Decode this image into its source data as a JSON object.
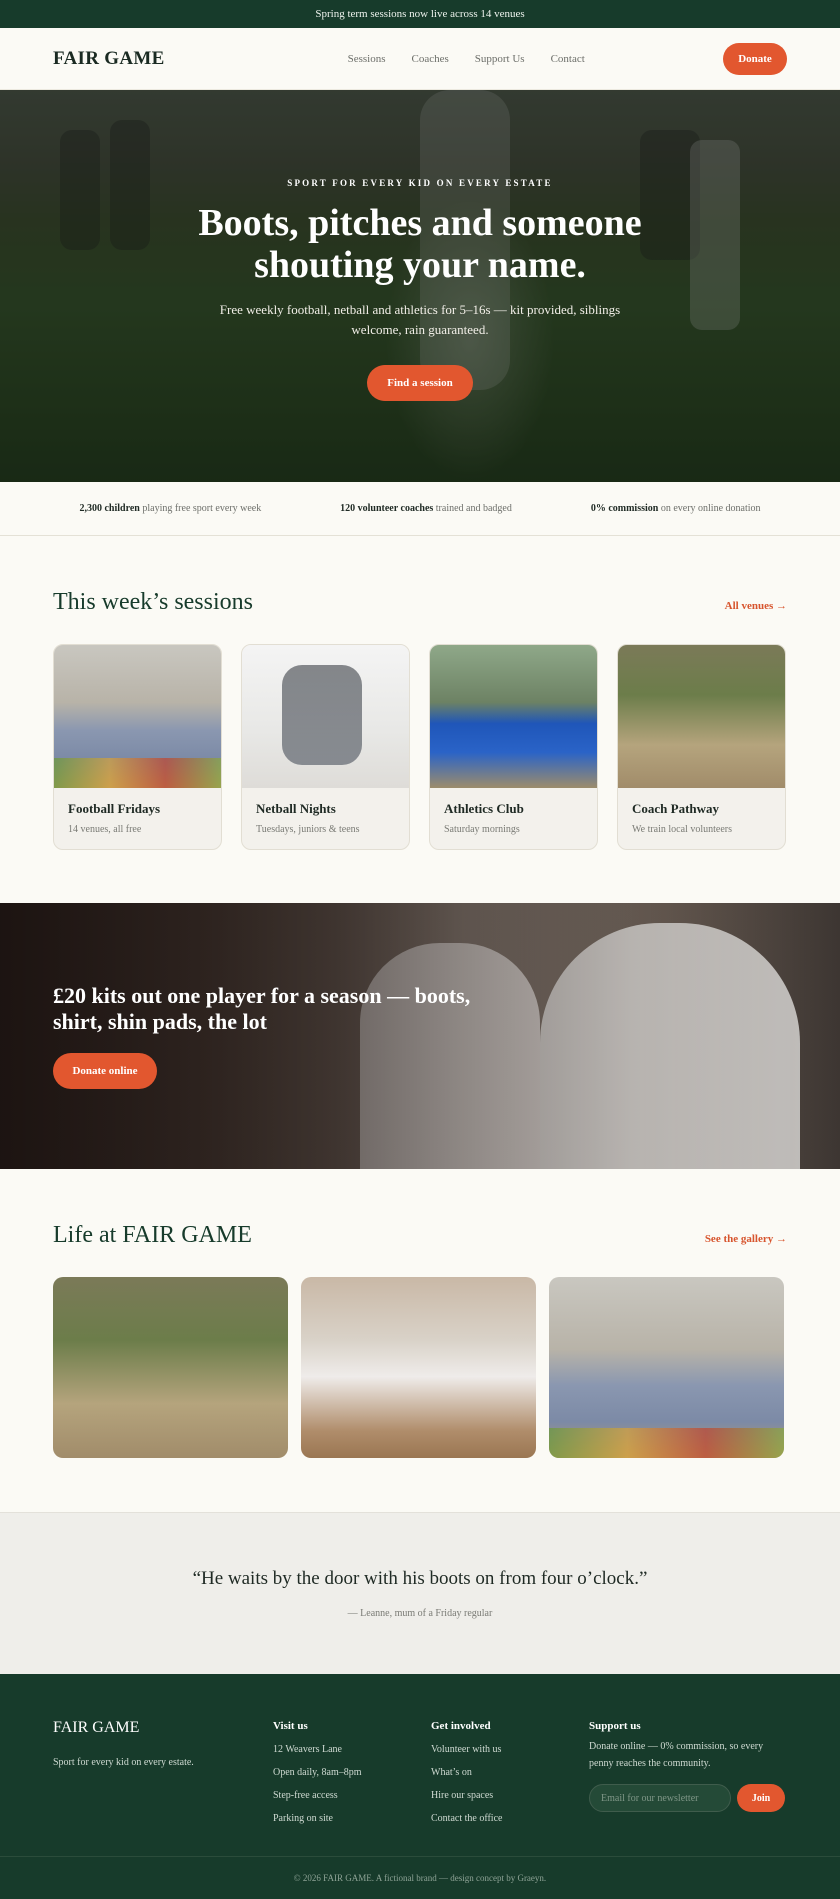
{
  "announcement": "Spring term sessions now live across 14 venues",
  "header": {
    "brand": "FAIR GAME",
    "nav": [
      "Sessions",
      "Coaches",
      "Support Us",
      "Contact"
    ],
    "donate_label": "Donate"
  },
  "hero": {
    "kicker": "SPORT FOR EVERY KID ON EVERY ESTATE",
    "title": "Boots, pitches and someone shouting your name.",
    "subtitle": "Free weekly football, netball and athletics for 5–16s — kit provided, siblings welcome, rain guaranteed.",
    "cta_label": "Find a session"
  },
  "stats": [
    {
      "strong": "2,300 children",
      "rest": " playing free sport every week"
    },
    {
      "strong": "120 volunteer coaches",
      "rest": " trained and badged"
    },
    {
      "strong": "0% commission",
      "rest": " on every online donation"
    }
  ],
  "sessions": {
    "title": "This week’s sessions",
    "link": "All venues →",
    "cards": [
      {
        "title": "Football Fridays",
        "sub": "14 venues, all free"
      },
      {
        "title": "Netball Nights",
        "sub": "Tuesdays, juniors & teens"
      },
      {
        "title": "Athletics Club",
        "sub": "Saturday mornings"
      },
      {
        "title": "Coach Pathway",
        "sub": "We train local volunteers"
      }
    ]
  },
  "banner": {
    "title": "£20 kits out one player for a season — boots, shirt, shin pads, the lot",
    "cta_label": "Donate online"
  },
  "life": {
    "title": "Life at FAIR GAME",
    "link": "See the gallery →"
  },
  "quote": {
    "text": "“He waits by the door with his boots on from four o’clock.”",
    "attribution": "— Leanne, mum of a Friday regular"
  },
  "footer": {
    "brand": "FAIR GAME",
    "tagline": "Sport for every kid on every estate.",
    "visit": {
      "heading": "Visit us",
      "items": [
        "12 Weavers Lane",
        "Open daily, 8am–8pm",
        "Step-free access",
        "Parking on site"
      ]
    },
    "involved": {
      "heading": "Get involved",
      "items": [
        "Volunteer with us",
        "What’s on",
        "Hire our spaces",
        "Contact the office"
      ]
    },
    "support": {
      "heading": "Support us",
      "desc": "Donate online — 0% commission, so every penny reaches the community.",
      "newsletter_placeholder": "Email for our newsletter",
      "join_label": "Join"
    },
    "copyright": "© 2026 FAIR GAME. A fictional brand — design concept by Graeyn."
  }
}
